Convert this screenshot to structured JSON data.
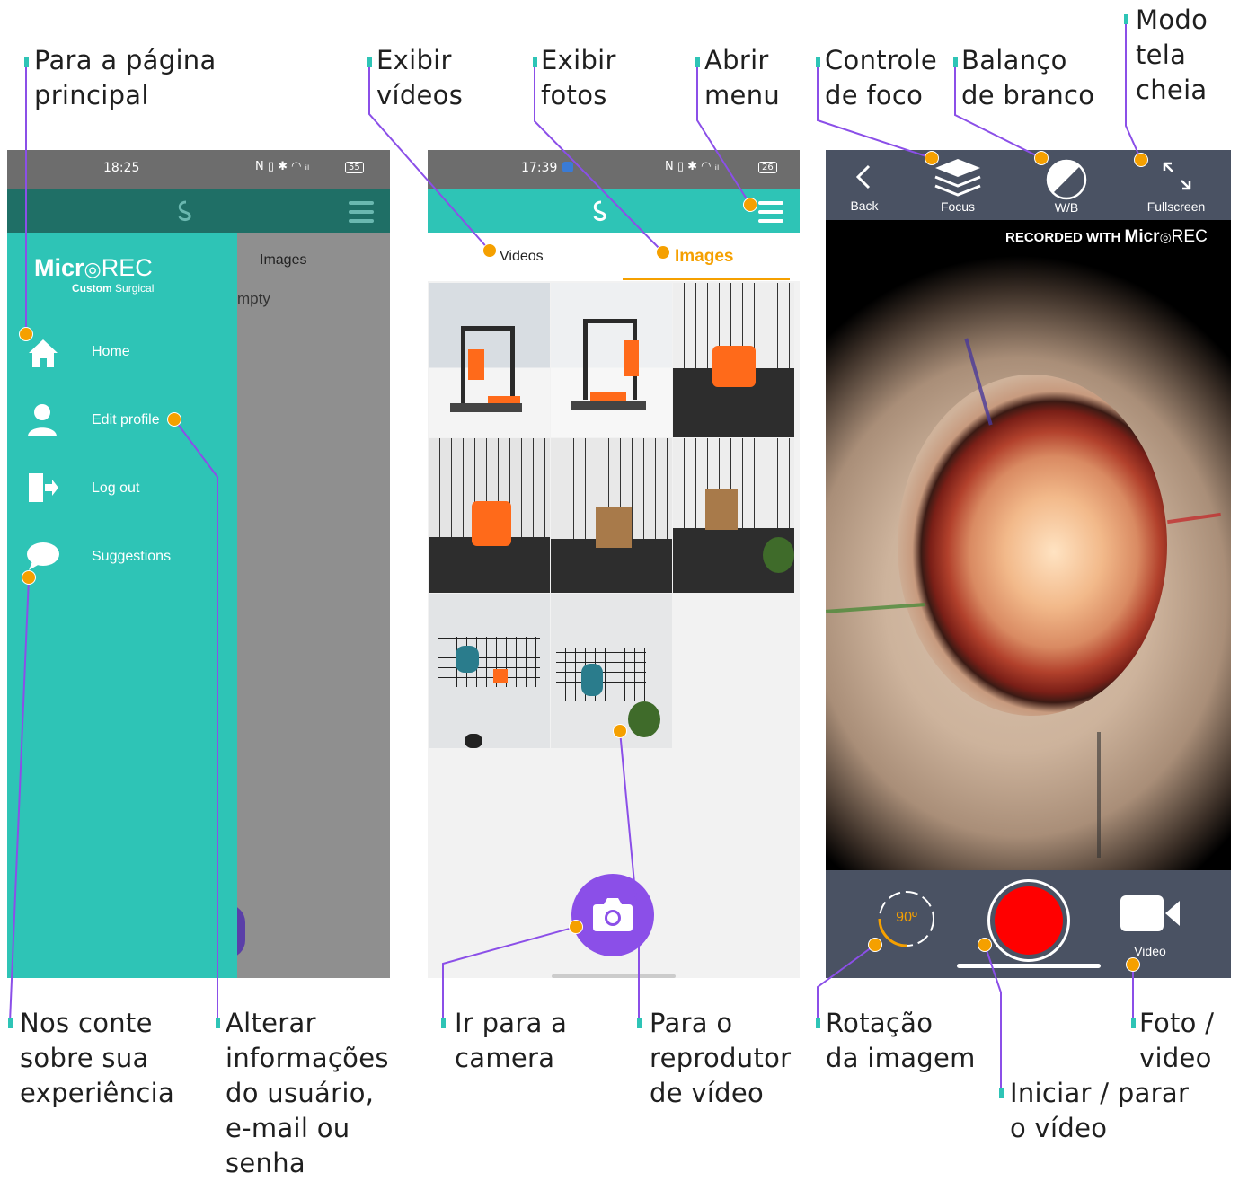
{
  "colors": {
    "teal": "#2ec4b6",
    "orange": "#f5a000",
    "purple": "#8b4fe8",
    "dark_teal": "#1f6f66",
    "slate": "#4a5263"
  },
  "callouts": {
    "home": [
      "Para a página",
      "principal"
    ],
    "videos": [
      "Exibir",
      "vídeos"
    ],
    "photos": [
      "Exibir",
      "fotos"
    ],
    "menu": [
      "Abrir",
      "menu"
    ],
    "focus": [
      "Controle",
      "de foco"
    ],
    "wb": [
      "Balanço",
      "de branco"
    ],
    "fullscreen": [
      "Modo",
      "tela",
      "cheia"
    ],
    "suggestions": [
      "Nos conte",
      "sobre sua",
      "experiência"
    ],
    "edit_profile": [
      "Alterar",
      "informações",
      "do usuário,",
      "e-mail ou",
      "senha"
    ],
    "camera": [
      "Ir para a",
      "camera"
    ],
    "player": [
      "Para o",
      "reprodutor",
      "de vídeo"
    ],
    "rotation": [
      "Rotação",
      "da imagem"
    ],
    "photo_video": [
      "Foto /",
      "video"
    ],
    "record": [
      "Iniciar / parar",
      "o vídeo"
    ]
  },
  "phone1": {
    "time": "18:25",
    "status_icons": "N ▯ ✱ ◠ ⁴ᴳ▮ ",
    "battery": "55",
    "brand": {
      "micro": "Micr",
      "rec": "REC",
      "sub_bold": "Custom",
      "sub_light": "Surgical"
    },
    "page_label": "Images",
    "page_text": "mpty",
    "menu": [
      {
        "label": "Home",
        "icon": "home-icon"
      },
      {
        "label": "Edit profile",
        "icon": "user-icon"
      },
      {
        "label": "Log out",
        "icon": "logout-icon"
      },
      {
        "label": "Suggestions",
        "icon": "chat-bubble-icon"
      }
    ]
  },
  "phone2": {
    "time": "17:39",
    "battery": "26",
    "tabs": {
      "videos": "Videos",
      "images": "Images"
    }
  },
  "phone3": {
    "back": "Back",
    "focus": "Focus",
    "wb": "W/B",
    "fullscreen": "Fullscreen",
    "watermark_pre": "RECORDED WITH",
    "watermark_micro": "Micr",
    "watermark_rec": "REC",
    "rotation": "90º",
    "video": "Video"
  }
}
